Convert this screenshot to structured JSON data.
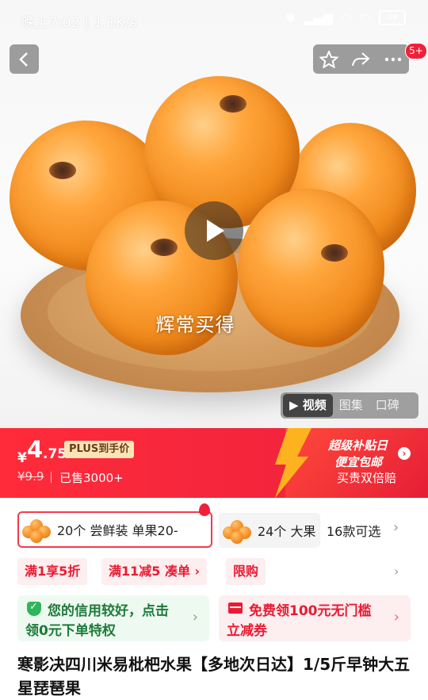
{
  "status_bar": {
    "time_speed": "晚上7:02 | 1.1K/s",
    "battery": "98"
  },
  "hero": {
    "slogan": "辉常买得",
    "media_tabs": [
      "视频",
      "图集",
      "口碑"
    ],
    "cart_badge": "5+"
  },
  "price": {
    "currency": "¥",
    "integer": "4",
    "decimal": ".75",
    "plus_label": "PLUS到手价",
    "original": "¥9.9",
    "sold": "已售3000+",
    "promo_title": "超级补贴日",
    "promo_sub": "便宜包邮",
    "promo_note": "买贵双倍赔"
  },
  "variants": {
    "selected_label": "20个  尝鲜装  单果20-",
    "other_label": "24个  大果",
    "count": "16款可选"
  },
  "chips": [
    "满1享5折",
    "满11减5  凑单 ›",
    "限购"
  ],
  "cards": {
    "credit_line1": "您的信用较好，点击",
    "credit_line2": "领0元下单特权",
    "coupon_line1": "免费领100元无门槛",
    "coupon_line2": "立减券"
  },
  "product": {
    "title": "寒影决四川米易枇杷水果【多地次日达】1/5斤早钟大五星琵琶果"
  },
  "colors": {
    "accent_red": "#f4253c",
    "plus_gold": "#fbe5b8",
    "credit_green": "#1d7a3a"
  }
}
